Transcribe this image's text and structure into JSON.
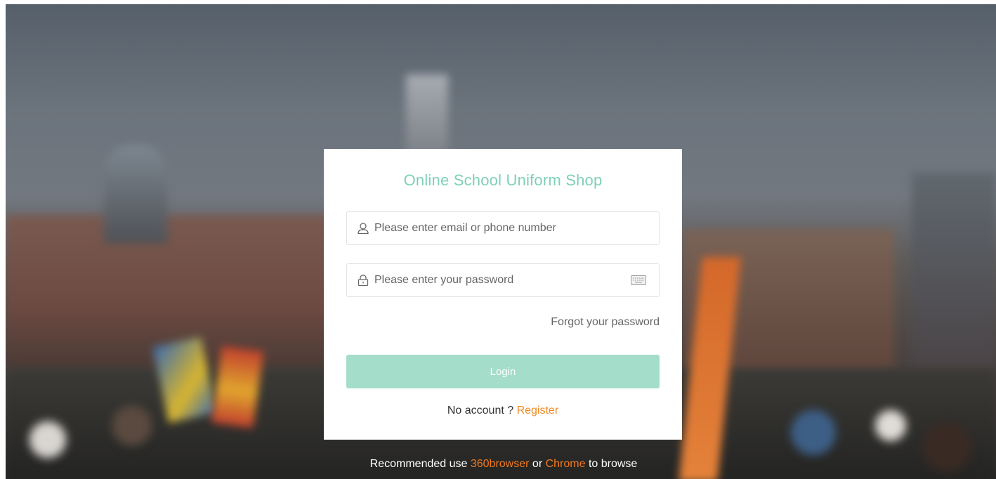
{
  "card": {
    "title": "Online School Uniform Shop",
    "username_placeholder": "Please enter email or phone number",
    "password_placeholder": "Please enter your password",
    "forgot_label": "Forgot your password",
    "login_label": "Login",
    "no_account_text": "No account ? ",
    "register_label": "Register"
  },
  "footer": {
    "prefix": "Recommended use ",
    "browser_1": "360browser",
    "middle": " or ",
    "browser_2": "Chrome",
    "suffix": " to browse"
  },
  "icons": {
    "username": "user-icon",
    "password": "lock-icon",
    "keyboard": "keyboard-icon"
  },
  "colors": {
    "accent": "#7fd0b8",
    "button": "#a5ddcb",
    "link": "#f08a24"
  }
}
